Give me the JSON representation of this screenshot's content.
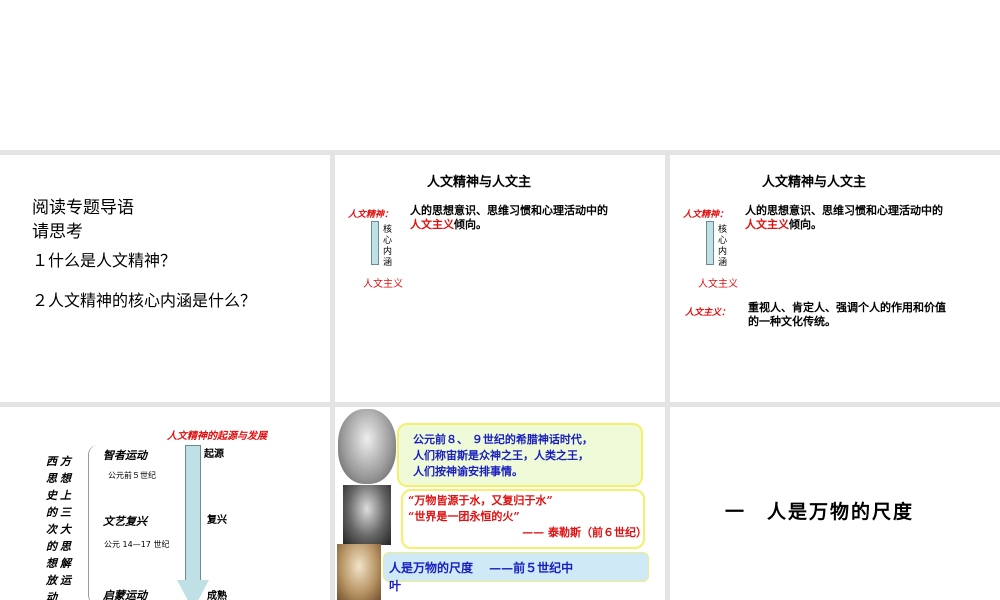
{
  "slide1": {
    "title": "阅读专题导语",
    "prompt": "请思考",
    "q1": "１什么是人文精神？",
    "q2": "２人文精神的核心内涵是什么？"
  },
  "slide2": {
    "title": "人文精神与人文主",
    "label": "人文精神：",
    "def1": "人的思想意识、思维习惯和心理活动中的",
    "def_red": "人文主义",
    "def_end": "倾向。",
    "arrow_label": "核\n心\n内\n涵",
    "target": "人文主义"
  },
  "slide3": {
    "title": "人文精神与人文主",
    "label": "人文精神：",
    "def1": "人的思想意识、思维习惯和心理活动中的",
    "def_red": "人文主义",
    "def_end": "倾向。",
    "arrow_label": "核\n心\n内\n涵",
    "target": "人文主义",
    "label2": "人文主义：",
    "def2a": "重视人、肯定人、强调个人的作用和价值",
    "def2b": "的一种文化传统。"
  },
  "slide4": {
    "title": "人文精神的起源与发展",
    "side": "西方思想史上的三次大的思想解放运动",
    "m1": "智者运动",
    "d1": "公元前５世纪",
    "m2": "文艺复兴",
    "d2": "公元 14—17 世纪",
    "m3": "启蒙运动",
    "s1": "起源",
    "s2": "复兴",
    "s3": "成熟"
  },
  "slide5": {
    "b1": [
      "公元前８、 ９世纪的希腊神话时代，",
      "人们称宙斯是众神之王，人类之王，",
      "人们按神谕安排事情。"
    ],
    "b2": [
      "“万物皆源于水，又复归于水”",
      "“世界是一团永恒的火”",
      "—— 泰勒斯（前６世纪）"
    ],
    "b3a": "人是万物的尺度　 ——前５世纪中",
    "b3b": "叶"
  },
  "slide6": {
    "title": "一　人是万物的尺度"
  }
}
